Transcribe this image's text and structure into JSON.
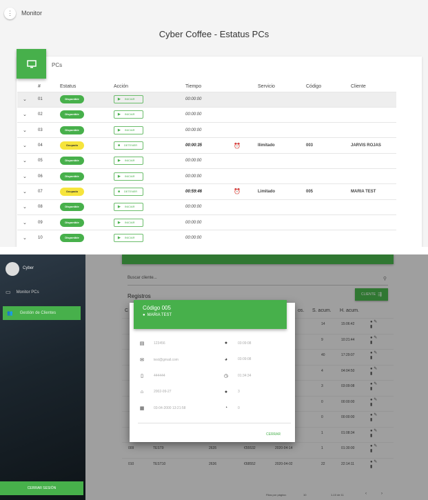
{
  "monitor": {
    "nav_title": "Monitor",
    "page_title": "Cyber Coffee - Estatus PCs",
    "card_title": "PCs",
    "columns": [
      "#",
      "Estatus",
      "Acción",
      "Tiempo",
      "Servicio",
      "Código",
      "Cliente"
    ],
    "rows": [
      {
        "num": "01",
        "status": "Disponible",
        "action": "INICIAR",
        "time": "00:00:00",
        "service": "",
        "code": "",
        "client": ""
      },
      {
        "num": "02",
        "status": "Disponible",
        "action": "INICIAR",
        "time": "00:00:00",
        "service": "",
        "code": "",
        "client": ""
      },
      {
        "num": "03",
        "status": "Disponible",
        "action": "INICIAR",
        "time": "00:00:00",
        "service": "",
        "code": "",
        "client": ""
      },
      {
        "num": "04",
        "status": "Ocupado",
        "action": "DETENER",
        "time": "00:00:35",
        "service": "Ilimitado",
        "code": "003",
        "client": "JARVIS ROJAS"
      },
      {
        "num": "05",
        "status": "Disponible",
        "action": "INICIAR",
        "time": "00:00:00",
        "service": "",
        "code": "",
        "client": ""
      },
      {
        "num": "06",
        "status": "Disponible",
        "action": "INICIAR",
        "time": "00:00:00",
        "service": "",
        "code": "",
        "client": ""
      },
      {
        "num": "07",
        "status": "Ocupado",
        "action": "DETENER",
        "time": "00:59:46",
        "service": "Limitado",
        "code": "005",
        "client": "MARIA TEST"
      },
      {
        "num": "08",
        "status": "Disponible",
        "action": "INICIAR",
        "time": "00:00:00",
        "service": "",
        "code": "",
        "client": ""
      },
      {
        "num": "09",
        "status": "Disponible",
        "action": "INICIAR",
        "time": "00:00:00",
        "service": "",
        "code": "",
        "client": ""
      },
      {
        "num": "10",
        "status": "Disponible",
        "action": "INICIAR",
        "time": "00:00:00",
        "service": "",
        "code": "",
        "client": ""
      }
    ]
  },
  "clients": {
    "sidebar": {
      "name": "Cyber",
      "items": [
        "Monitor PCs",
        "Gestión de Clientes"
      ],
      "logout": "CERRAR SESIÓN"
    },
    "search_placeholder": "Buscar cliente...",
    "registros_title": "Registros",
    "client_button": "CLIENTE",
    "headers": [
      "C",
      "os.",
      "S. acum.",
      "H. acum."
    ],
    "rows": [
      {
        "s": "14",
        "h": "15:06:42"
      },
      {
        "s": "9",
        "h": "10:21:44"
      },
      {
        "s": "40",
        "h": "17:29:07"
      },
      {
        "s": "4",
        "h": "04:04:50"
      },
      {
        "s": "3",
        "h": "03:09:08"
      },
      {
        "s": "0",
        "h": "00:00:00"
      },
      {
        "s": "0",
        "h": "00:00:00"
      },
      {
        "s": "1",
        "h": "01:08:34"
      },
      {
        "code": "009",
        "name": "TEST9",
        "c3": "2635",
        "c4": "€55532",
        "c5": "2020-04-14",
        "s": "1",
        "h": "01:30:00"
      },
      {
        "code": "010",
        "name": "TEST10",
        "c3": "2636",
        "c4": "€68552",
        "c5": "2020-04-02",
        "s": "22",
        "h": "22:14:11"
      }
    ],
    "pagination": {
      "per_page_label": "Filas por página:",
      "per_page": "10",
      "range": "1-10 de 11"
    },
    "modal": {
      "title": "Código 005",
      "subtitle": "MARIA TEST",
      "left": [
        {
          "icon": "id-card-icon",
          "glyph": "▤",
          "value": "123456"
        },
        {
          "icon": "email-icon",
          "glyph": "✉",
          "value": "test@gmail.com"
        },
        {
          "icon": "phone-icon",
          "glyph": "▯",
          "value": "444444"
        },
        {
          "icon": "cake-icon",
          "glyph": "⌂",
          "value": "2002-09-27"
        },
        {
          "icon": "calendar-icon",
          "glyph": "▦",
          "value": "03-04-2000 13:21:58"
        }
      ],
      "right": [
        {
          "icon": "clock-icon",
          "glyph": "●",
          "value": "03:09:08"
        },
        {
          "icon": "clock-history-icon",
          "glyph": "◕",
          "value": "03:09:08"
        },
        {
          "icon": "timer-icon",
          "glyph": "◷",
          "value": "01:34:34"
        },
        {
          "icon": "stopwatch-icon",
          "glyph": "●",
          "value": "3"
        },
        {
          "icon": "timer-off-icon",
          "glyph": "◔",
          "value": "0"
        }
      ],
      "close": "CERRAR"
    }
  }
}
